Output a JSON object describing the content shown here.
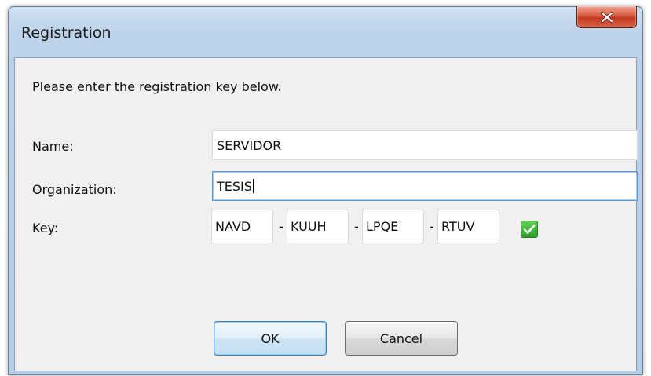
{
  "window": {
    "title": "Registration"
  },
  "dialog": {
    "instruction": "Please enter the registration key below."
  },
  "form": {
    "name_label": "Name:",
    "name_value": "SERVIDOR",
    "organization_label": "Organization:",
    "organization_value": "TESIS",
    "key_label": "Key:",
    "key_segments": [
      "NAVD",
      "KUUH",
      "LPQE",
      "RTUV"
    ],
    "separator": "-",
    "key_valid": true
  },
  "buttons": {
    "ok_label": "OK",
    "cancel_label": "Cancel"
  },
  "icons": {
    "close": "close-icon",
    "valid": "checkmark-icon"
  },
  "colors": {
    "close_button": "#d9583e",
    "valid_check": "#2f9f2a",
    "focus_border": "#5b9ad6"
  }
}
